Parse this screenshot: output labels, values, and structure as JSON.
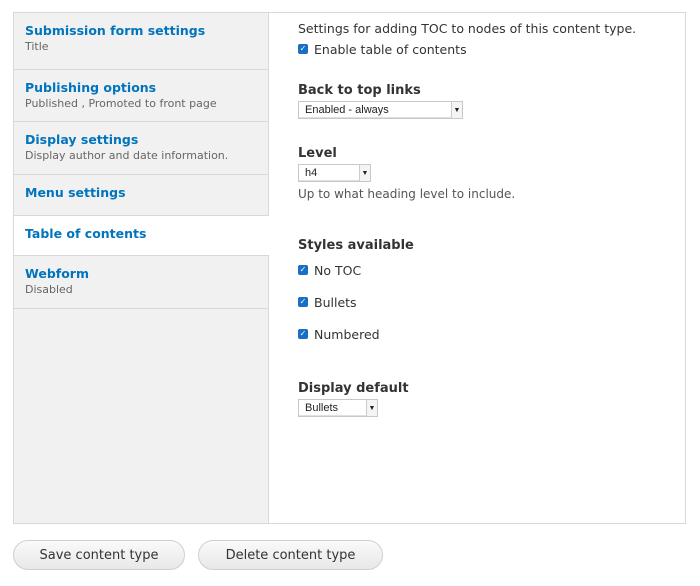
{
  "vertical_tabs": [
    {
      "title": "Submission form settings",
      "summary": "Title",
      "selected": false
    },
    {
      "title": "Publishing options",
      "summary": "Published , Promoted to front page",
      "selected": false
    },
    {
      "title": "Display settings",
      "summary": "Display author and date information.",
      "selected": false
    },
    {
      "title": "Menu settings",
      "summary": "",
      "selected": false
    },
    {
      "title": "Table of contents",
      "summary": "",
      "selected": true
    },
    {
      "title": "Webform",
      "summary": "Disabled",
      "selected": false
    }
  ],
  "toc_pane": {
    "description": "Settings for adding TOC to nodes of this content type.",
    "enable_checkbox": {
      "label": "Enable table of contents",
      "checked": true
    },
    "back_to_top": {
      "label": "Back to top links",
      "value": "Enabled - always"
    },
    "level": {
      "label": "Level",
      "value": "h4",
      "help": "Up to what heading level to include."
    },
    "styles": {
      "label": "Styles available",
      "options": [
        {
          "label": "No TOC",
          "checked": true
        },
        {
          "label": "Bullets",
          "checked": true
        },
        {
          "label": "Numbered",
          "checked": true
        }
      ]
    },
    "display_default": {
      "label": "Display default",
      "value": "Bullets"
    }
  },
  "actions": {
    "save_label": "Save content type",
    "delete_label": "Delete content type"
  },
  "icons": {
    "checkbox_checked": "✓",
    "dropdown_arrow": "▼"
  },
  "colors": {
    "link": "#0074bd",
    "checkbox": "#1a6fc4",
    "tab_bg": "#f1f1f1"
  }
}
